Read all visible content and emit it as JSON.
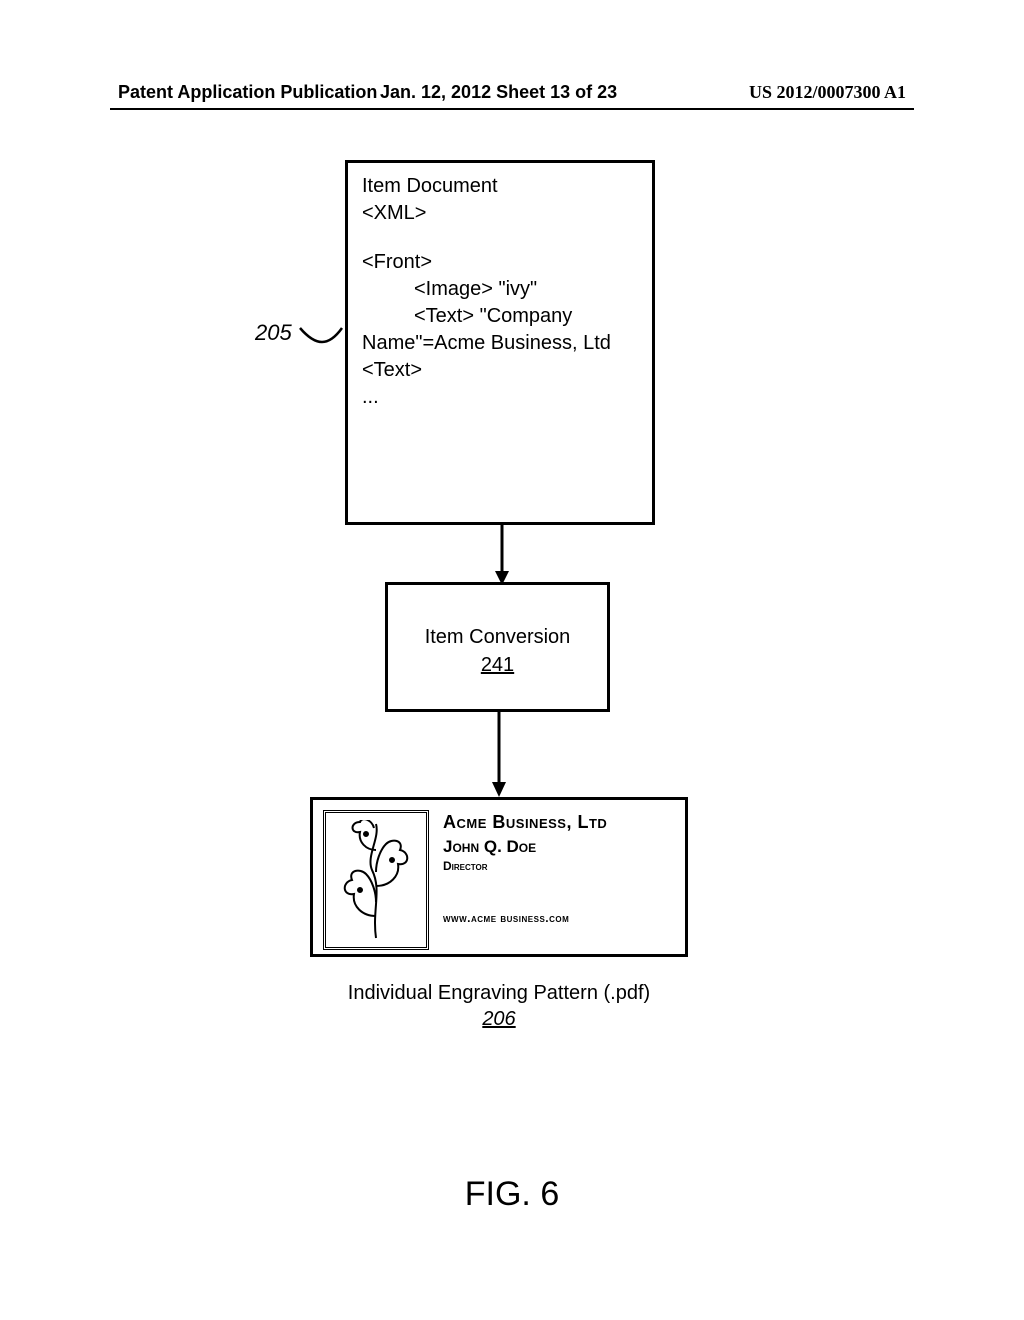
{
  "header": {
    "left": "Patent Application Publication",
    "center": "Jan. 12, 2012  Sheet 13 of 23",
    "right": "US 2012/0007300 A1"
  },
  "box1": {
    "line1": "Item Document",
    "line2": "<XML>",
    "line3": "<Front>",
    "line4": "<Image> \"ivy\"",
    "line5": "<Text> \"Company",
    "line6": "Name\"=Acme Business, Ltd",
    "line7": "<Text>",
    "line8": "..."
  },
  "ref205": "205",
  "box2": {
    "label": "Item Conversion",
    "num": "241"
  },
  "card": {
    "company": "Acme Business, Ltd",
    "name": "John Q. Doe",
    "title": "Director",
    "url": "www.acme business.com"
  },
  "caption206": {
    "text": "Individual Engraving Pattern (.pdf)",
    "num": "206"
  },
  "figure": "FIG. 6"
}
